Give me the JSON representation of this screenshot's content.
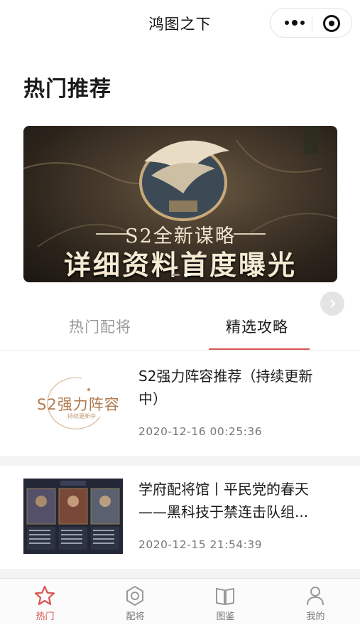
{
  "nav": {
    "title": "鸿图之下"
  },
  "section": {
    "title": "热门推荐"
  },
  "banner": {
    "subtitle": "S2全新谋略",
    "headline": "详细资料首度曝光",
    "slide_count": 2,
    "active_slide": 2
  },
  "tabs": [
    {
      "label": "热门配将",
      "active": false
    },
    {
      "label": "精选攻略",
      "active": true
    }
  ],
  "articles": [
    {
      "title": "S2强力阵容推荐（持续更新中）",
      "date": "2020-12-16 00:25:36",
      "thumb_text": "S2强力阵容",
      "thumb_subtext": "持续更新中"
    },
    {
      "title": "学府配将馆丨平民党的春天——黑科技于禁连击队组...",
      "date": "2020-12-15 21:54:39"
    }
  ],
  "tabbar": [
    {
      "label": "热门",
      "icon": "star-icon",
      "active": true
    },
    {
      "label": "配将",
      "icon": "hexagon-icon",
      "active": false
    },
    {
      "label": "图鉴",
      "icon": "book-icon",
      "active": false
    },
    {
      "label": "我的",
      "icon": "person-icon",
      "active": false
    }
  ],
  "colors": {
    "accent": "#d9534f",
    "muted": "#9a9a9a"
  }
}
